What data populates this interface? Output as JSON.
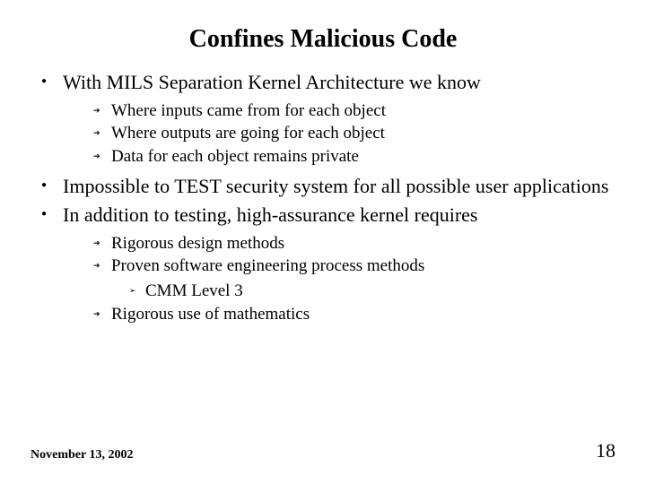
{
  "title": "Confines Malicious Code",
  "bullets": {
    "b1": "With MILS Separation Kernel Architecture we know",
    "b1a": "Where inputs came from for each object",
    "b1b": "Where outputs are going for each object",
    "b1c": "Data for each object remains private",
    "b2": "Impossible to TEST security system for all possible user applications",
    "b3": "In addition to testing, high-assurance kernel requires",
    "b3a": "Rigorous design methods",
    "b3b": "Proven software engineering process methods",
    "b3b1": "CMM Level 3",
    "b3c": "Rigorous use of mathematics"
  },
  "footer": {
    "date": "November 13, 2002",
    "page": "18"
  }
}
